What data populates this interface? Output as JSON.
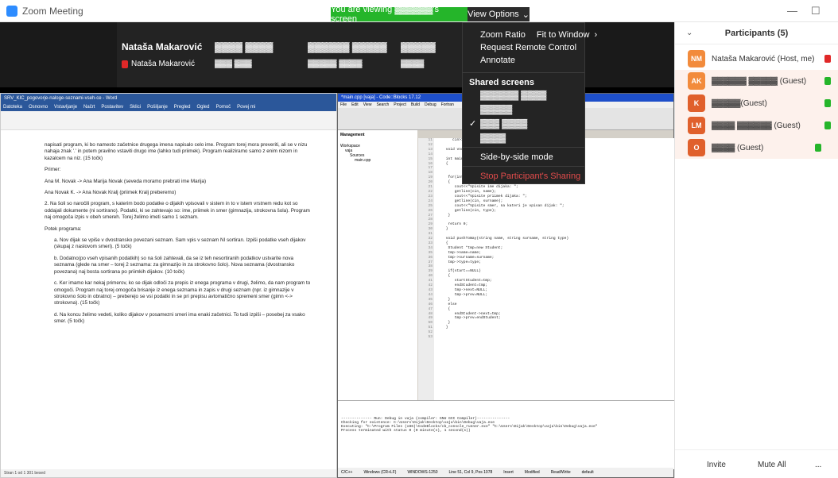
{
  "window": {
    "title": "Zoom Meeting"
  },
  "banner": {
    "viewing_text": "You are viewing ▓▓▓▓▓▓'s screen",
    "view_options": "View Options"
  },
  "strip": [
    {
      "name": "Nataša Makarović",
      "sub": "Nataša Makarović"
    },
    {
      "name": "▓▓▓▓ ▓▓▓▓",
      "sub": "▓▓▓ ▓▓▓"
    },
    {
      "name": "▓▓▓▓▓▓ ▓▓▓▓▓",
      "sub": "▓▓▓▓▓ ▓▓▓▓"
    },
    {
      "name": "▓▓▓▓▓",
      "sub": "▓▓▓▓"
    }
  ],
  "menu": {
    "zoom_ratio": "Zoom Ratio",
    "fit_to_window": "Fit to Window",
    "request_remote_control": "Request Remote Control",
    "annotate": "Annotate",
    "shared_screens": "Shared screens",
    "screens": [
      "▓▓▓▓▓▓ ▓▓▓▓",
      "▓▓▓▓▓",
      "▓▓▓ ▓▓▓▓",
      "▓▓▓▓"
    ],
    "side_by_side": "Side-by-side mode",
    "stop_sharing": "Stop Participant's Sharing"
  },
  "panel": {
    "title": "Participants (5)",
    "participants": [
      {
        "initials": "NM",
        "color": "#f28b3c",
        "name": "Nataša Makarović (Host, me)",
        "mic": "#e02828"
      },
      {
        "initials": "AK",
        "color": "#f28b3c",
        "name": "▓▓▓▓▓▓ ▓▓▓▓▓ (Guest)",
        "mic": "#25b52a"
      },
      {
        "initials": "K",
        "color": "#e0602c",
        "name": "▓▓▓▓▓(Guest)",
        "mic": "#25b52a"
      },
      {
        "initials": "LM",
        "color": "#e0602c",
        "name": "▓▓▓▓ ▓▓▓▓▓▓ (Guest)",
        "mic": "#25b52a"
      },
      {
        "initials": "O",
        "color": "#e0602c",
        "name": "▓▓▓▓ (Guest)",
        "mic": "#25b52a"
      }
    ],
    "invite": "Invite",
    "mute_all": "Mute All",
    "more": "..."
  },
  "word": {
    "title": "SRV_KIC_pogovorje-naloge-seznami-vseh-ce - Word",
    "menu": [
      "Datoteka",
      "Osnovno",
      "Vstavljanje",
      "Načrt",
      "Postavitev",
      "Sklici",
      "Pošiljanje",
      "Pregled",
      "Ogled",
      "Pomoč",
      "Povej mi"
    ],
    "para1": "napisati program, ki bo namesto začetnice drugega imena napisalo celo ime. Program torej mora preveriti, ali se v nizu nahaja znak '.' in potem pravilno vstaviti drugo ime (lahko tudi priimek). Program realiziramo samo z enim nizom in kazalcem na niz. (15 točk)",
    "primer": "Primer:",
    "ex1": "Ana M. Novak -> Ana Marija Novak (seveda moramo prebrati ime Marija)",
    "ex2": "Ana Novak K. -> Ana Novak Kralj (priimek Kralj preberemo)",
    "para2": "2. Na šoli so naročili program, s katerim bodo podatke o dijakih vpisovali v sistem in to v istem vrstnem redu kot so oddajali dokumente (ni sortirano). Podatki, ki se zahtevajo so: ime, priimek in smer (gimnazija, strokovna šola). Program naj omogoča izpis v obeh smereh. Torej želimo imeti samo 1 seznam.",
    "potek": "Potek programa:",
    "a": "a. Nov dijak se vpiše v dvostransko povezani seznam. Sam vpis v seznam NI sortiran. Izpiši podatke vseh dijakov (skupaj z naslovom smeri). (5 točk)",
    "b": "b. Dodatno(po vseh vpisanih podatkih) so na šoli zahtevali, da se iz teh nesortiranih podatkov ustvarite nova seznama (glede na smer – torej 2 seznama: za gimnazijo in za strokovno šolo). Nova seznama (dvostransko povezana) naj bosta sortirana po priimkih dijakov. (10 točk)",
    "c": "c. Ker imamo kar nekaj primerov, ko se dijak odloči za prepis iz enega programa v drugi, želimo, da nam program to omogoči. Program naj torej omogoča brisanje iz enega seznama in zapis v drugi seznam (npr. iz gimnazije v strokovno šolo in obratno) – preberejo se vsi podatki in se pri prepisu avtomatično spremeni smer (gimn <-> strokovna). (15 točk)",
    "d": "d. Na koncu želimo vedeti, koliko dijakov v posamezni smeri ima enaki začetnici. To tudi izpiši – posebej za vsako smer. (5 točk)",
    "status": "Stran 1 od 1   301 besed"
  },
  "codeblocks": {
    "title": "*main.cpp [vaja] - Code::Blocks 17.12",
    "menu": [
      "File",
      "Edit",
      "View",
      "Search",
      "Project",
      "Build",
      "Debug",
      "Fortran"
    ],
    "mgmt_title": "Management",
    "workspace": "Workspace",
    "project": "vaja",
    "sources": "Sources",
    "file": "main.cpp",
    "log_tab": "Build log",
    "log": "-------------- Run: Debug in vaja (compiler: GNU GCC Compiler)---------------\nChecking for existence: C:\\Users\\Dijak\\Desktop\\vaja\\bin\\Debug\\vaja.exe\nExecuting: \"C:\\Program Files (x86)\\CodeBlocks/cb_console_runner.exe\" \"C:\\Users\\Dijak\\Desktop\\vaja\\bin\\Debug\\vaja.exe\"\nProcess terminated with status 0 (0 minute(s), 1 second(s))",
    "status": [
      "C/C++",
      "Windows (CR+LF)",
      "WINDOWS-1250",
      "Line 51, Col 9, Pos 1078",
      "Insert",
      "Modified",
      "Read/Write",
      "default"
    ],
    "code": "    cin>>s;\n\n void vnos(string &name, string &surname, string &type);\n\n int main()\n {\n\n\n  for(int i=0; i<n; i++)\n  {\n     cout<<\"Vpisite ime dijaka: \";\n     getline(cin, name);\n     cout<<\"Vpisite priimek dijaka: \";\n     getline(cin, surname);\n     cout<<\"Vpisite smer, na kateri je vpisan dijak: \";\n     getline(cin, type);\n  }\n\n  return 0;\n }\n\n void pushToWay(string name, string surname, string type)\n {\n  Student *tmp=new Student;\n  tmp->name=name;\n  tmp->surname=surname;\n  tmp->type=type;\n\n  if(start==NULL)\n  {\n     startStudent=tmp;\n     endStudent=tmp;\n     tmp->next=NULL;\n     tmp->prev=NULL;\n  }\n  else\n  {\n     endStudent->next=tmp;\n     tmp->prev=endStudent;\n  }\n }",
    "gutter": "11\n12\n13\n14\n15\n16\n17\n18\n19\n20\n21\n22\n23\n24\n25\n26\n27\n28\n29\n30\n31\n32\n33\n34\n35\n36\n37\n38\n39\n40\n41\n42\n43\n44\n45\n46\n47\n48\n49\n50\n51\n52\n53"
  }
}
